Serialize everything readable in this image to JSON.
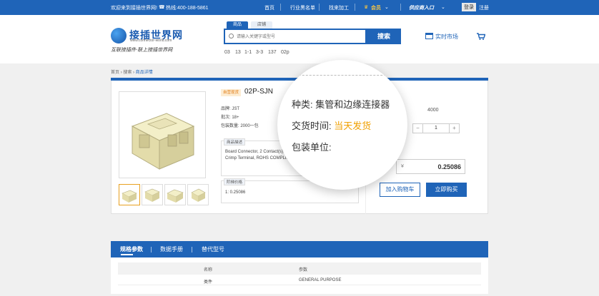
{
  "topbar": {
    "welcome": "欢迎来到接插世界网!",
    "hotline": "热线:400-188-5861",
    "links": [
      "首页",
      "行业黑名单",
      "找来加工"
    ],
    "member": "会员",
    "entry": "供应商入口",
    "login": "登录",
    "register": "注册"
  },
  "logo": {
    "title": "接插世界网",
    "url": "www.connector-world.com",
    "slogan": "互联接插件·联上接插世界网"
  },
  "search": {
    "tabs": [
      "商品",
      "店铺"
    ],
    "placeholder": "请输入关键字或型号",
    "button": "搜索",
    "hot_terms": [
      "03",
      "13",
      "1-1",
      "3-3",
      "137",
      "02p"
    ]
  },
  "market": "实时市场",
  "breadcrumb": [
    "首页",
    "搜索",
    "商品详情"
  ],
  "product": {
    "tag": "自营现货",
    "name": "02P-SJN",
    "brand": "品牌: JST",
    "batch": "批次: 18+",
    "package_qty": "包装数量: 2000一包",
    "desc_label": "商品描述",
    "desc_line1": "Board Connector, 2 Contact(s),",
    "desc_line2": "Crimp Terminal, ROHS COMPLIA",
    "price_label": "阶梯价格",
    "price_tier": "1: 0.25086",
    "stock": "4000",
    "qty": "1",
    "minus": "−",
    "plus": "+",
    "currency": "¥",
    "unit_price": "0.25086",
    "add_cart": "加入购物车",
    "buy_now": "立即购买"
  },
  "magnifier": {
    "category_label": "种类:",
    "category_value": "集管和边缘连接器",
    "delivery_label": "交货时间:",
    "delivery_value": "当天发货",
    "package_label": "包装单位:"
  },
  "detail_tabs": [
    "规格参数",
    "数据手册",
    "替代型号"
  ],
  "spec_table": {
    "headers": [
      "名称",
      "参数"
    ],
    "rows": [
      [
        "类件",
        "GENERAL PURPOSE"
      ],
      [
        "",
        ""
      ]
    ]
  },
  "colors": {
    "brand_blue": "#1f64b8",
    "highlight_orange": "#f0a000"
  }
}
